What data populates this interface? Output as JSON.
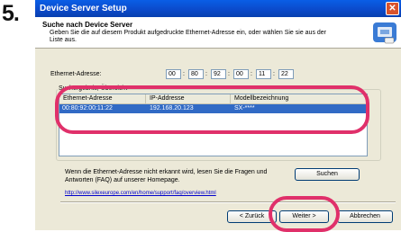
{
  "step_number": "5.",
  "window": {
    "title": "Device Server Setup",
    "close_label": "✕"
  },
  "header": {
    "title": "Suche nach Device Server",
    "description": "Geben Sie die auf diesem Produkt aufgedruckte Ethernet-Adresse ein, oder wählen Sie sie aus der Liste aus."
  },
  "ethernet": {
    "label": "Ethernet-Adresse:",
    "octets": [
      "00",
      "80",
      "92",
      "00",
      "11",
      "22"
    ]
  },
  "results": {
    "group_label": "Suchergebnis, Übersicht",
    "columns": [
      "Ethernet-Adresse",
      "IP-Addresse",
      "Modellbezeichnung"
    ],
    "rows": [
      {
        "ethernet": "00:80:92:00:11:22",
        "ip": "192.168.20.123",
        "model": "SX-****",
        "selected": true
      }
    ]
  },
  "hint": "Wenn die Ethernet-Adresse nicht erkannt wird, lesen Sie die Fragen und Antworten (FAQ) auf unserer Homepage.",
  "search_button": "Suchen",
  "faq_link": "http://www.silexeurope.com/en/home/support/faq/overview.html",
  "buttons": {
    "back": "< Zurück",
    "next": "Weiter >",
    "cancel": "Abbrechen"
  },
  "colors": {
    "highlight_ring": "#e0306a",
    "selection": "#316ac5",
    "titlebar": "#0b49c9"
  }
}
